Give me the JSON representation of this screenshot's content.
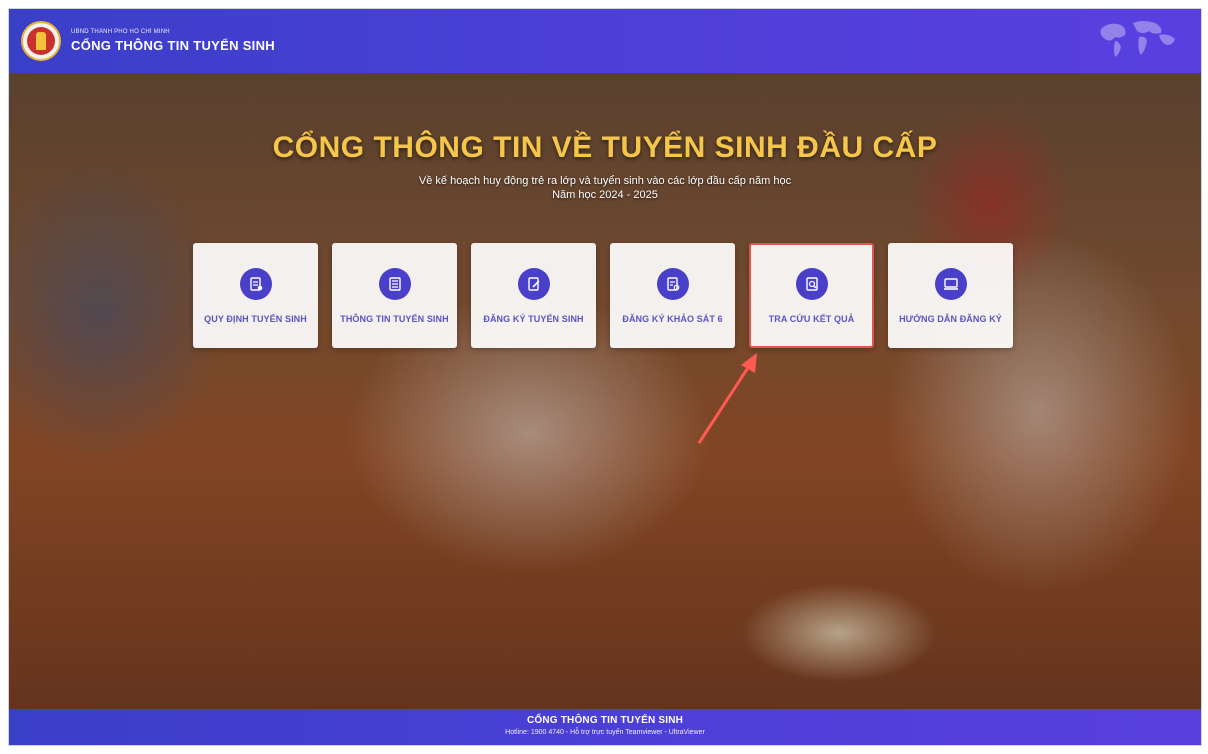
{
  "header": {
    "sub_title": "UBND THÀNH PHỐ HỒ CHÍ MINH",
    "title": "CỔNG THÔNG TIN TUYỂN SINH",
    "icon": "world-map-icon"
  },
  "hero": {
    "title": "CỔNG THÔNG TIN VỀ TUYỂN SINH ĐẦU CẤP",
    "description_line1": "Về kế hoạch huy động trẻ ra lớp và tuyển sinh vào các lớp đầu cấp năm học",
    "description_line2": "Năm học 2024 - 2025"
  },
  "cards": [
    {
      "label": "QUY ĐỊNH TUYỂN SINH",
      "icon": "regulation-icon"
    },
    {
      "label": "THÔNG TIN TUYỂN SINH",
      "icon": "info-list-icon"
    },
    {
      "label": "ĐĂNG KÝ TUYỂN SINH",
      "icon": "register-icon"
    },
    {
      "label": "ĐĂNG KÝ KHẢO SÁT 6",
      "icon": "survey-icon"
    },
    {
      "label": "TRA CỨU KẾT QUẢ",
      "icon": "search-result-icon"
    },
    {
      "label": "HƯỚNG DẪN ĐĂNG KÝ",
      "icon": "guide-icon"
    }
  ],
  "footer": {
    "title": "CỔNG THÔNG TIN TUYỂN SINH",
    "subtitle": "Hotline: 1900 4740 - Hỗ trợ trực tuyến Teamviewer - UltraViewer"
  },
  "colors": {
    "brand": "#4b3fd6",
    "title": "#f6c64a",
    "highlight": "#e0554f"
  }
}
